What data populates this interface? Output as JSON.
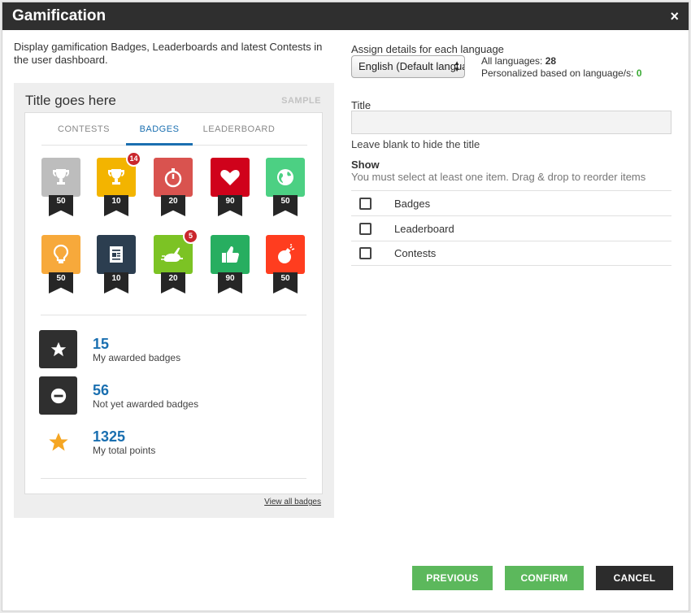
{
  "dialog": {
    "title": "Gamification",
    "close": "×"
  },
  "left": {
    "description": "Display gamification Badges, Leaderboards and latest Contests in the user dashboard.",
    "preview": {
      "title": "Title goes here",
      "sample": "SAMPLE",
      "tabs": [
        "CONTESTS",
        "BADGES",
        "LEADERBOARD"
      ],
      "active_tab": "BADGES",
      "badges_row1": [
        {
          "icon": "trophy-icon",
          "color": "#bdbdbd",
          "value": "50",
          "count": ""
        },
        {
          "icon": "trophy-icon",
          "color": "#f3b400",
          "value": "10",
          "count": "14"
        },
        {
          "icon": "stopwatch-icon",
          "color": "#d9534f",
          "value": "20",
          "count": ""
        },
        {
          "icon": "heart-icon",
          "color": "#d0021b",
          "value": "90",
          "count": ""
        },
        {
          "icon": "globe-icon",
          "color": "#4cd083",
          "value": "50",
          "count": ""
        }
      ],
      "badges_row2": [
        {
          "icon": "lightbulb-icon",
          "color": "#f7a93b",
          "value": "50",
          "count": ""
        },
        {
          "icon": "document-icon",
          "color": "#2c3e50",
          "value": "10",
          "count": ""
        },
        {
          "icon": "rabbit-icon",
          "color": "#7cc324",
          "value": "20",
          "count": "5"
        },
        {
          "icon": "thumbs-up-icon",
          "color": "#27ae60",
          "value": "90",
          "count": ""
        },
        {
          "icon": "bomb-icon",
          "color": "#ff3d1f",
          "value": "50",
          "count": ""
        }
      ],
      "stats": [
        {
          "number": "15",
          "label": "My awarded badges"
        },
        {
          "number": "56",
          "label": "Not yet awarded badges"
        },
        {
          "number": "1325",
          "label": "My total points"
        }
      ],
      "view_all": "View all badges"
    }
  },
  "right": {
    "assign_label": "Assign details for each language",
    "language_value": "English (Default language)",
    "all_languages_label": "All languages:",
    "all_languages_count": "28",
    "personalized_label": "Personalized based on language/s:",
    "personalized_count": "0",
    "title_label": "Title",
    "title_value": "",
    "title_hint": "Leave blank to hide the title",
    "show_label": "Show",
    "show_hint": "You must select at least one item. Drag & drop to reorder items",
    "show_items": [
      "Badges",
      "Leaderboard",
      "Contests"
    ]
  },
  "buttons": {
    "previous": "PREVIOUS",
    "confirm": "CONFIRM",
    "cancel": "CANCEL"
  },
  "colors": {
    "accent": "#1a6fb0",
    "green_button": "#5cb85c",
    "titlebar": "#2f2f2f"
  }
}
